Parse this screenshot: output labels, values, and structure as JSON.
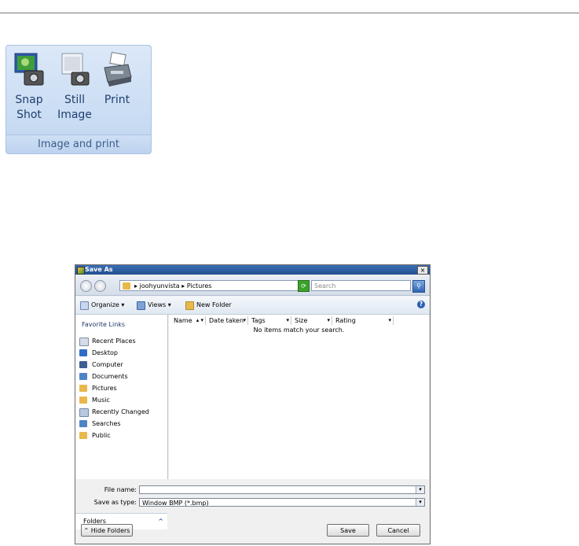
{
  "ribbon": {
    "buttons": [
      {
        "label": "Snap\nShot",
        "icon": "snapshot-camera-icon"
      },
      {
        "label": "Still\nImage",
        "icon": "still-image-camera-icon"
      },
      {
        "label": "Print",
        "icon": "printer-icon"
      }
    ],
    "group_label": "Image and print"
  },
  "dialog": {
    "title": "Save As",
    "close": "×",
    "address": {
      "path": "▸ joohyunvista ▸ Pictures",
      "dropdown": "▾"
    },
    "search_placeholder": "Search",
    "toolbar": {
      "organize": "Organize ▾",
      "views": "Views ▾",
      "new_folder": "New Folder",
      "help": "?"
    },
    "sidebar": {
      "header": "Favorite Links",
      "items": [
        "Recent Places",
        "Desktop",
        "Computer",
        "Documents",
        "Pictures",
        "Music",
        "Recently Changed",
        "Searches",
        "Public"
      ],
      "folders_label": "Folders",
      "folders_chevron": "^"
    },
    "columns": [
      "Name",
      "Date taken",
      "Tags",
      "Size",
      "Rating"
    ],
    "empty_message": "No items match your search.",
    "file_name_label": "File name:",
    "file_name_value": "",
    "save_as_type_label": "Save as type:",
    "save_as_type_value": "Window BMP (*.bmp)",
    "hide_folders": "Hide Folders",
    "save": "Save",
    "cancel": "Cancel"
  },
  "colors": {
    "ribbon_bg": "#d3e3f6",
    "title_bar": "#2f5ea3",
    "folder_yellow": "#e8b84b"
  }
}
